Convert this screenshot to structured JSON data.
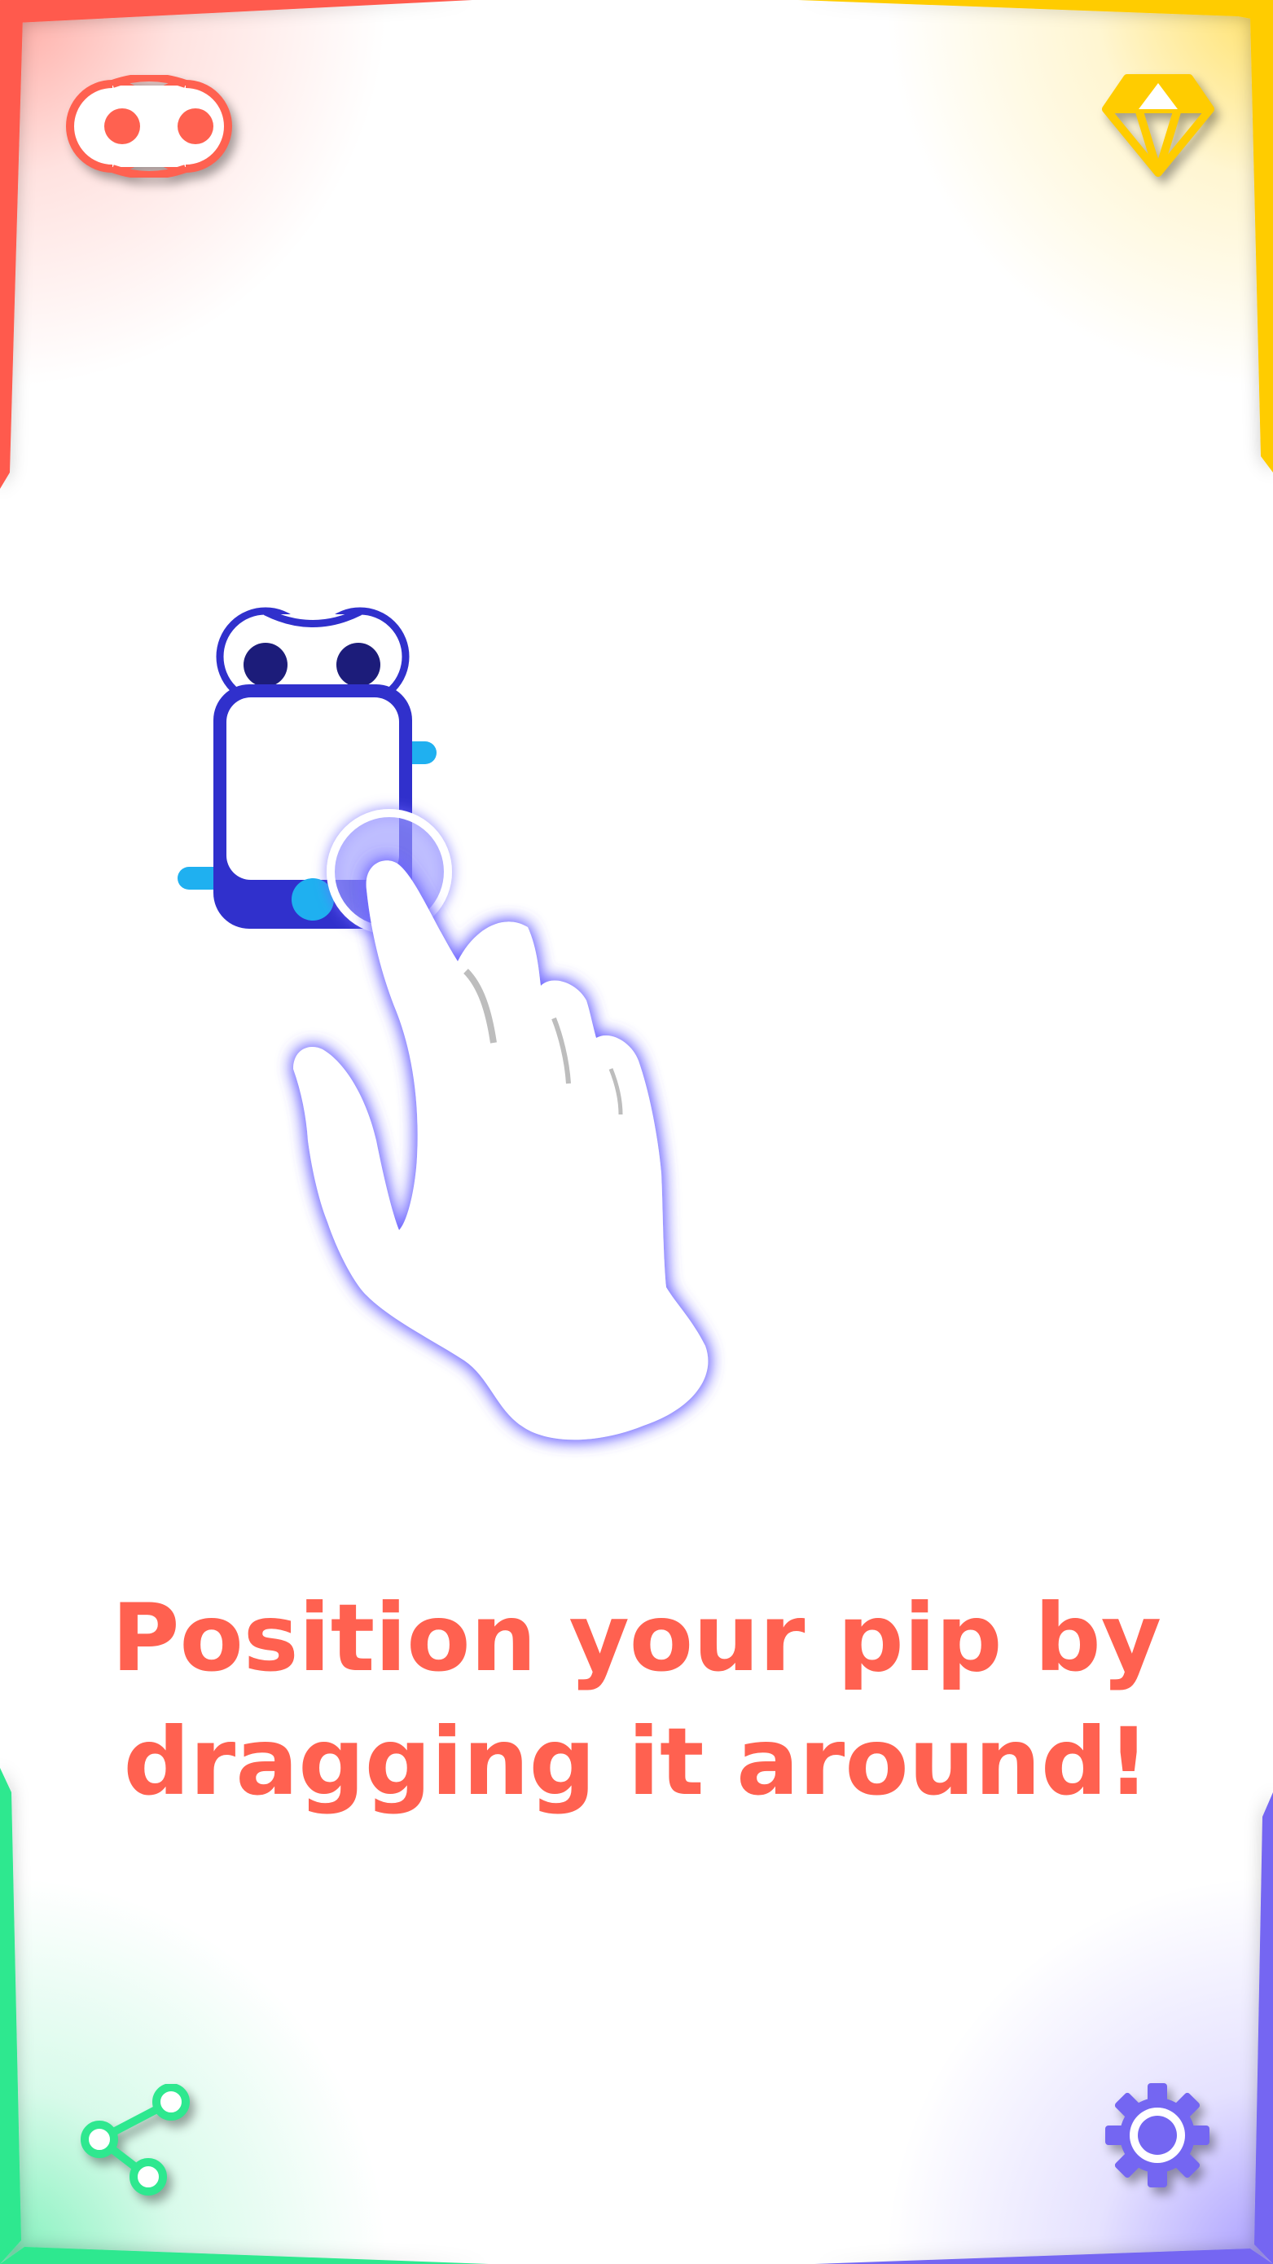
{
  "instruction": {
    "line1": "Position your pip by",
    "line2": "dragging it around!"
  },
  "corners": {
    "top_left": {
      "icon": "googly-eyes-icon",
      "color": "#ff6150"
    },
    "top_right": {
      "icon": "diamond-gem-icon",
      "color": "#ffcc00"
    },
    "bottom_left": {
      "icon": "share-icon",
      "color": "#2ee88f"
    },
    "bottom_right": {
      "icon": "gear-icon",
      "color": "#7466f2"
    }
  },
  "illustration": {
    "pip_color": "#3030cc",
    "accent_color": "#1fb0f0",
    "hand": "pointing-hand",
    "hand_glow_color": "#6f67ff"
  }
}
